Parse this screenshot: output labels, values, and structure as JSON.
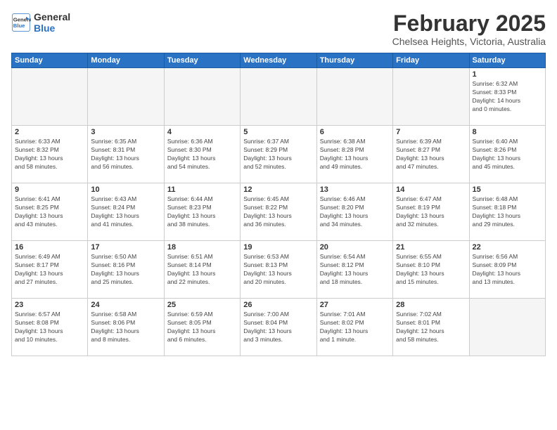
{
  "header": {
    "logo_line1": "General",
    "logo_line2": "Blue",
    "title": "February 2025",
    "subtitle": "Chelsea Heights, Victoria, Australia"
  },
  "weekdays": [
    "Sunday",
    "Monday",
    "Tuesday",
    "Wednesday",
    "Thursday",
    "Friday",
    "Saturday"
  ],
  "weeks": [
    [
      {
        "day": "",
        "info": ""
      },
      {
        "day": "",
        "info": ""
      },
      {
        "day": "",
        "info": ""
      },
      {
        "day": "",
        "info": ""
      },
      {
        "day": "",
        "info": ""
      },
      {
        "day": "",
        "info": ""
      },
      {
        "day": "1",
        "info": "Sunrise: 6:32 AM\nSunset: 8:33 PM\nDaylight: 14 hours\nand 0 minutes."
      }
    ],
    [
      {
        "day": "2",
        "info": "Sunrise: 6:33 AM\nSunset: 8:32 PM\nDaylight: 13 hours\nand 58 minutes."
      },
      {
        "day": "3",
        "info": "Sunrise: 6:35 AM\nSunset: 8:31 PM\nDaylight: 13 hours\nand 56 minutes."
      },
      {
        "day": "4",
        "info": "Sunrise: 6:36 AM\nSunset: 8:30 PM\nDaylight: 13 hours\nand 54 minutes."
      },
      {
        "day": "5",
        "info": "Sunrise: 6:37 AM\nSunset: 8:29 PM\nDaylight: 13 hours\nand 52 minutes."
      },
      {
        "day": "6",
        "info": "Sunrise: 6:38 AM\nSunset: 8:28 PM\nDaylight: 13 hours\nand 49 minutes."
      },
      {
        "day": "7",
        "info": "Sunrise: 6:39 AM\nSunset: 8:27 PM\nDaylight: 13 hours\nand 47 minutes."
      },
      {
        "day": "8",
        "info": "Sunrise: 6:40 AM\nSunset: 8:26 PM\nDaylight: 13 hours\nand 45 minutes."
      }
    ],
    [
      {
        "day": "9",
        "info": "Sunrise: 6:41 AM\nSunset: 8:25 PM\nDaylight: 13 hours\nand 43 minutes."
      },
      {
        "day": "10",
        "info": "Sunrise: 6:43 AM\nSunset: 8:24 PM\nDaylight: 13 hours\nand 41 minutes."
      },
      {
        "day": "11",
        "info": "Sunrise: 6:44 AM\nSunset: 8:23 PM\nDaylight: 13 hours\nand 38 minutes."
      },
      {
        "day": "12",
        "info": "Sunrise: 6:45 AM\nSunset: 8:22 PM\nDaylight: 13 hours\nand 36 minutes."
      },
      {
        "day": "13",
        "info": "Sunrise: 6:46 AM\nSunset: 8:20 PM\nDaylight: 13 hours\nand 34 minutes."
      },
      {
        "day": "14",
        "info": "Sunrise: 6:47 AM\nSunset: 8:19 PM\nDaylight: 13 hours\nand 32 minutes."
      },
      {
        "day": "15",
        "info": "Sunrise: 6:48 AM\nSunset: 8:18 PM\nDaylight: 13 hours\nand 29 minutes."
      }
    ],
    [
      {
        "day": "16",
        "info": "Sunrise: 6:49 AM\nSunset: 8:17 PM\nDaylight: 13 hours\nand 27 minutes."
      },
      {
        "day": "17",
        "info": "Sunrise: 6:50 AM\nSunset: 8:16 PM\nDaylight: 13 hours\nand 25 minutes."
      },
      {
        "day": "18",
        "info": "Sunrise: 6:51 AM\nSunset: 8:14 PM\nDaylight: 13 hours\nand 22 minutes."
      },
      {
        "day": "19",
        "info": "Sunrise: 6:53 AM\nSunset: 8:13 PM\nDaylight: 13 hours\nand 20 minutes."
      },
      {
        "day": "20",
        "info": "Sunrise: 6:54 AM\nSunset: 8:12 PM\nDaylight: 13 hours\nand 18 minutes."
      },
      {
        "day": "21",
        "info": "Sunrise: 6:55 AM\nSunset: 8:10 PM\nDaylight: 13 hours\nand 15 minutes."
      },
      {
        "day": "22",
        "info": "Sunrise: 6:56 AM\nSunset: 8:09 PM\nDaylight: 13 hours\nand 13 minutes."
      }
    ],
    [
      {
        "day": "23",
        "info": "Sunrise: 6:57 AM\nSunset: 8:08 PM\nDaylight: 13 hours\nand 10 minutes."
      },
      {
        "day": "24",
        "info": "Sunrise: 6:58 AM\nSunset: 8:06 PM\nDaylight: 13 hours\nand 8 minutes."
      },
      {
        "day": "25",
        "info": "Sunrise: 6:59 AM\nSunset: 8:05 PM\nDaylight: 13 hours\nand 6 minutes."
      },
      {
        "day": "26",
        "info": "Sunrise: 7:00 AM\nSunset: 8:04 PM\nDaylight: 13 hours\nand 3 minutes."
      },
      {
        "day": "27",
        "info": "Sunrise: 7:01 AM\nSunset: 8:02 PM\nDaylight: 13 hours\nand 1 minute."
      },
      {
        "day": "28",
        "info": "Sunrise: 7:02 AM\nSunset: 8:01 PM\nDaylight: 12 hours\nand 58 minutes."
      },
      {
        "day": "",
        "info": ""
      }
    ]
  ]
}
